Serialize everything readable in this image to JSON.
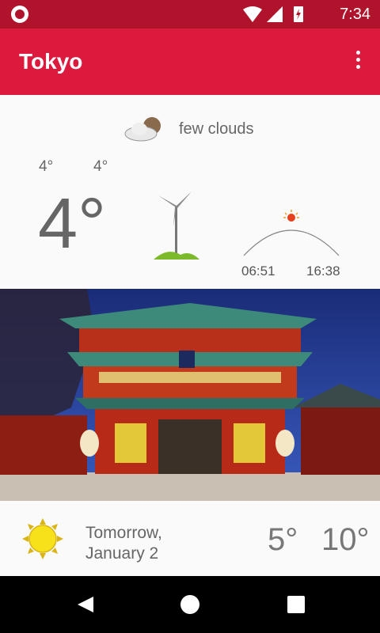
{
  "status_bar": {
    "time": "7:34"
  },
  "app_bar": {
    "title": "Tokyo"
  },
  "current": {
    "condition": "few clouds",
    "temp_low": "4°",
    "temp_high": "4°",
    "temp": "4°",
    "sunrise": "06:51",
    "sunset": "16:38"
  },
  "forecast": {
    "day_line1": "Tomorrow,",
    "day_line2": "January 2",
    "low": "5°",
    "high": "10°"
  },
  "colors": {
    "status_bar": "#b0142c",
    "app_bar": "#dc1a3e",
    "accent_sun": "#f7e11b"
  }
}
